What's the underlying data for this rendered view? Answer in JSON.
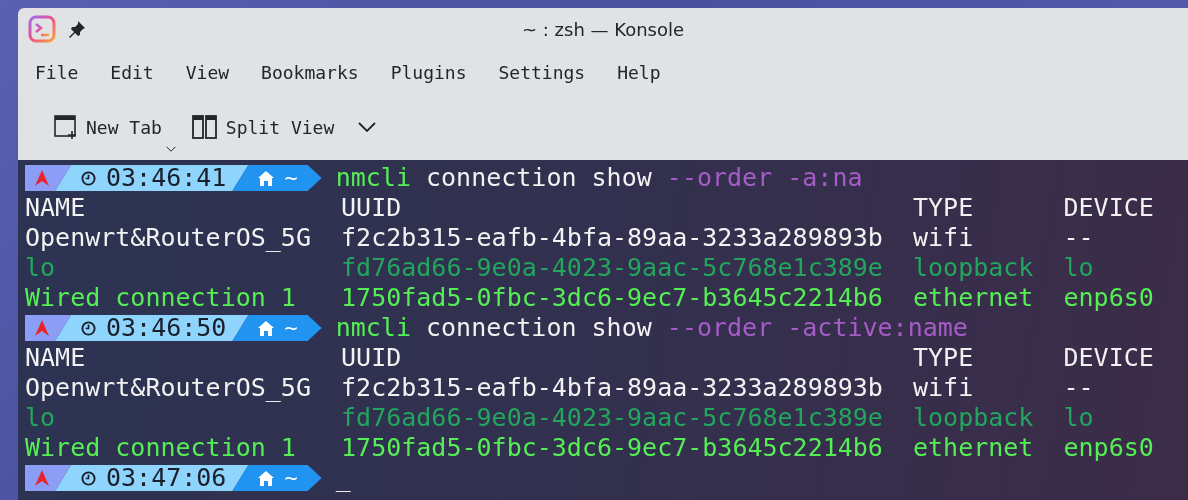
{
  "window": {
    "title": "~ : zsh — Konsole"
  },
  "menu": [
    "File",
    "Edit",
    "View",
    "Bookmarks",
    "Plugins",
    "Settings",
    "Help"
  ],
  "toolbar": [
    {
      "kind": "new-tab",
      "label": "New Tab"
    },
    {
      "kind": "split-view",
      "label": "Split View"
    }
  ],
  "terminal": {
    "blocks": [
      {
        "prompt": {
          "time": "03:46:41",
          "dir": "~"
        },
        "command": {
          "program": "nmcli",
          "args": "connection show",
          "options": "--order -a:na"
        },
        "output": [
          {
            "color": "#f2f2f2",
            "cells": [
              "NAME",
              "UUID",
              "TYPE",
              "DEVICE"
            ]
          },
          {
            "color": "#f2f2f2",
            "cells": [
              "Openwrt&RouterOS_5G",
              "f2c2b315-eafb-4bfa-89aa-3233a289893b",
              "wifi",
              "--"
            ]
          },
          {
            "color": "#22a55c",
            "cells": [
              "lo",
              "fd76ad66-9e0a-4023-9aac-5c768e1c389e",
              "loopback",
              "lo"
            ]
          },
          {
            "color": "#55ee55",
            "cells": [
              "Wired connection 1",
              "1750fad5-0fbc-3dc6-9ec7-b3645c2214b6",
              "ethernet",
              "enp6s0"
            ]
          }
        ]
      },
      {
        "prompt": {
          "time": "03:46:50",
          "dir": "~"
        },
        "command": {
          "program": "nmcli",
          "args": "connection show",
          "options": "--order -active:name"
        },
        "output": [
          {
            "color": "#f2f2f2",
            "cells": [
              "NAME",
              "UUID",
              "TYPE",
              "DEVICE"
            ]
          },
          {
            "color": "#f2f2f2",
            "cells": [
              "Openwrt&RouterOS_5G",
              "f2c2b315-eafb-4bfa-89aa-3233a289893b",
              "wifi",
              "--"
            ]
          },
          {
            "color": "#22a55c",
            "cells": [
              "lo",
              "fd76ad66-9e0a-4023-9aac-5c768e1c389e",
              "loopback",
              "lo"
            ]
          },
          {
            "color": "#55ee55",
            "cells": [
              "Wired connection 1",
              "1750fad5-0fbc-3dc6-9ec7-b3645c2214b6",
              "ethernet",
              "enp6s0"
            ]
          }
        ]
      },
      {
        "prompt": {
          "time": "03:47:06",
          "dir": "~"
        },
        "cursor": "_"
      }
    ]
  }
}
